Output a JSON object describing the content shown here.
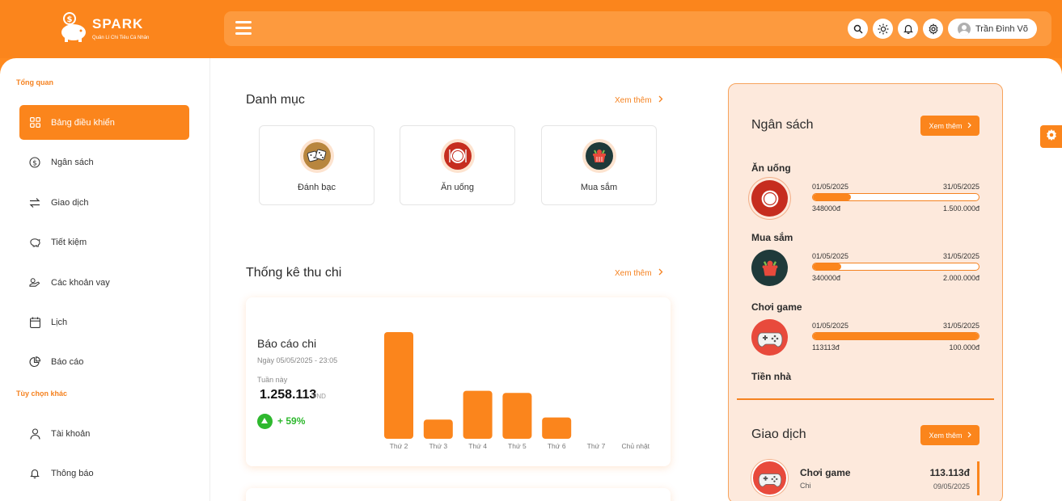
{
  "brand": {
    "name": "SPARK",
    "tagline": "Quản Lí Chi Tiêu Cá Nhân"
  },
  "header": {
    "icons": [
      "search-icon",
      "sun-icon",
      "bell-icon",
      "gear-icon"
    ],
    "user_name": "Trần Đình Võ"
  },
  "sidebar": {
    "section1": "Tổng quan",
    "items": [
      {
        "label": "Bảng điều khiển",
        "icon": "dashboard-icon",
        "active": true
      },
      {
        "label": "Ngân sách",
        "icon": "dollar-icon"
      },
      {
        "label": "Giao dịch",
        "icon": "transfer-icon"
      },
      {
        "label": "Tiết kiệm",
        "icon": "piggy-bank-icon"
      },
      {
        "label": "Các khoản vay",
        "icon": "loan-icon"
      },
      {
        "label": "Lịch",
        "icon": "calendar-icon"
      },
      {
        "label": "Báo cáo",
        "icon": "pie-chart-icon"
      }
    ],
    "section2": "Tùy chọn khác",
    "items2": [
      {
        "label": "Tài khoản",
        "icon": "user-icon"
      },
      {
        "label": "Thông báo",
        "icon": "bell-icon"
      }
    ]
  },
  "categories": {
    "title": "Danh mục",
    "more": "Xem thêm",
    "items": [
      {
        "label": "Đánh bạc",
        "icon": "dice-icon"
      },
      {
        "label": "Ăn uống",
        "icon": "plate-icon"
      },
      {
        "label": "Mua sắm",
        "icon": "basket-icon"
      }
    ]
  },
  "stats": {
    "title": "Thống kê thu chi",
    "more": "Xem thêm",
    "report_title": "Báo cáo chi",
    "report_date": "Ngày 05/05/2025 - 23:05",
    "week_label": "Tuần này",
    "amount": "1.258.113",
    "unit": "VND",
    "change": "+ 59%"
  },
  "chart_data": {
    "type": "bar",
    "categories": [
      "Thứ 2",
      "Thứ 3",
      "Thứ 4",
      "Thứ 5",
      "Thứ 6",
      "Thứ 7",
      "Chủ nhật"
    ],
    "values": [
      100,
      18,
      45,
      43,
      20,
      0,
      0
    ],
    "title": "",
    "xlabel": "",
    "ylabel": "",
    "ylim": [
      0,
      100
    ],
    "grid": false,
    "color": "#fb851c"
  },
  "budget": {
    "title": "Ngân sách",
    "more": "Xem thêm",
    "items": [
      {
        "name": "Ăn uống",
        "icon": "plate-icon",
        "start": "01/05/2025",
        "end": "31/05/2025",
        "spent": "348000đ",
        "limit": "1.500.000đ",
        "progress": 0.23
      },
      {
        "name": "Mua sắm",
        "icon": "basket-icon",
        "start": "01/05/2025",
        "end": "31/05/2025",
        "spent": "340000đ",
        "limit": "2.000.000đ",
        "progress": 0.17
      },
      {
        "name": "Chơi game",
        "icon": "gamepad-icon",
        "start": "01/05/2025",
        "end": "31/05/2025",
        "spent": "113113đ",
        "limit": "100.000đ",
        "progress": 1.0
      }
    ],
    "partial_item": "Tiền nhà"
  },
  "transactions": {
    "title": "Giao dịch",
    "more": "Xem thêm",
    "items": [
      {
        "name": "Chơi game",
        "type": "Chi",
        "amount": "113.113đ",
        "date": "09/05/2025",
        "icon": "gamepad-icon"
      }
    ]
  },
  "colors": {
    "accent": "#fb851c",
    "panel": "#fde9dc",
    "positive": "#2eb82e"
  }
}
